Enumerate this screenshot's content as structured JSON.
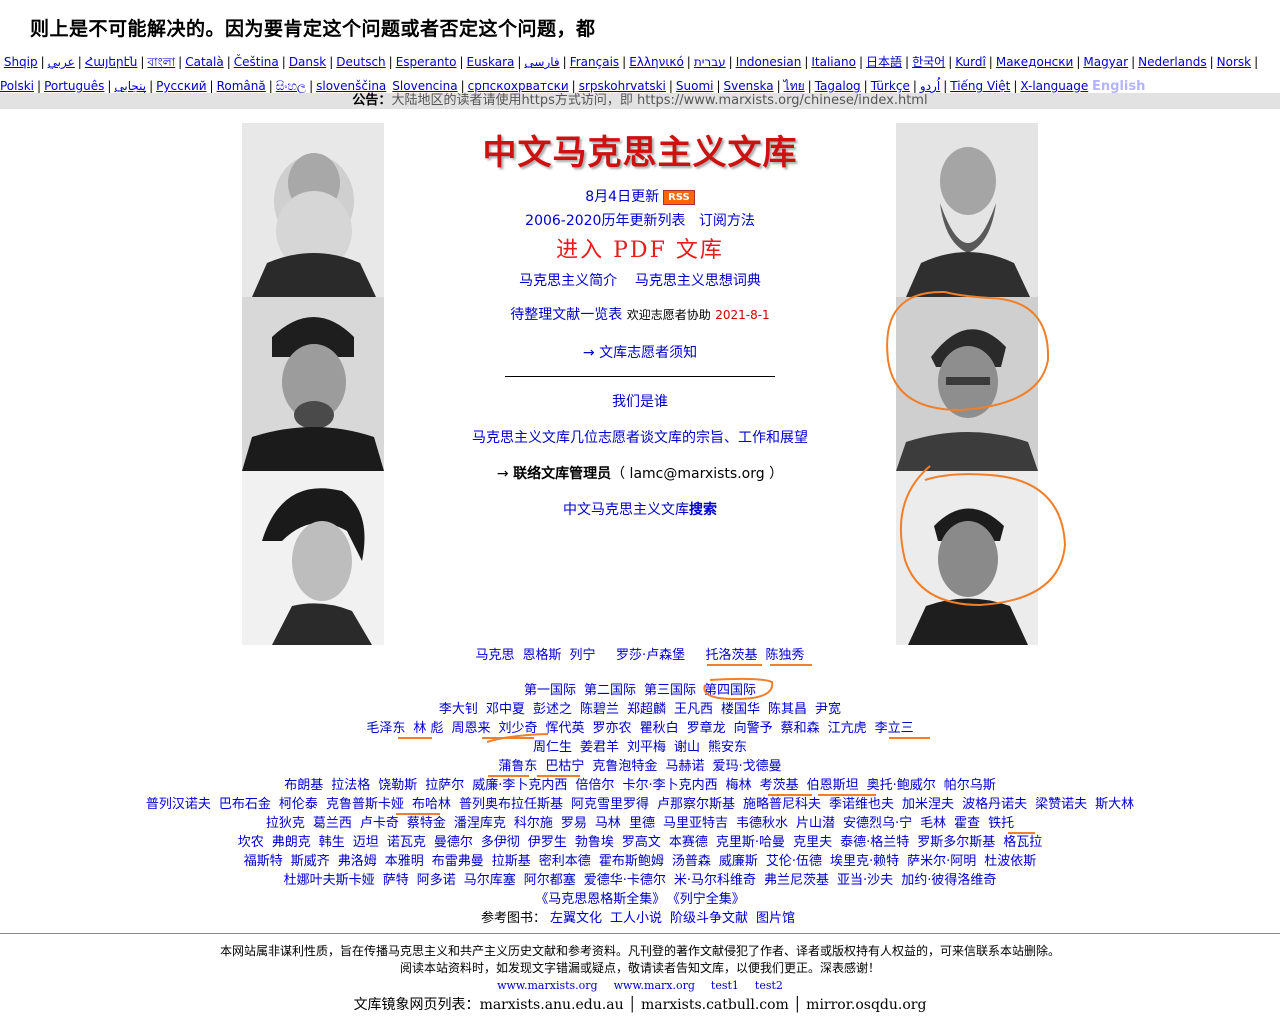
{
  "top_heading": "则上是不可能解决的。因为要肯定这个问题或者否定这个问题，都",
  "languages": {
    "row1": [
      "Shqip",
      "عربي",
      "Հայերէն",
      "বাংলা",
      "Català",
      "Čeština",
      "Dansk",
      "Deutsch",
      "Esperanto",
      "Euskara",
      "فارسی",
      "Français",
      "Ελληνικό",
      "עברית",
      "Indonesian",
      "Italiano",
      "日本語",
      "한국어",
      "Kurdî",
      "Македонски",
      "Magyar",
      "Nederlands",
      "Norsk"
    ],
    "row2": [
      "Polski",
      "Português",
      "پنجابی",
      "Русский",
      "Română",
      "සිංහල",
      "slovenščina",
      "Slovencina",
      "српскохрватски",
      "srpskohrvatski",
      "Suomi",
      "Svenska",
      "ไทย",
      "Tagalog",
      "Türkçe",
      "اُردو",
      "Tiếng Việt",
      "X-language"
    ],
    "english": "English"
  },
  "notice": {
    "label": "公告：",
    "text": "大陆地区的读者请使用https方式访问，即 https://www.marxists.org/chinese/index.html"
  },
  "center": {
    "title": "中文马克思主义文库",
    "update_date": "8月4日更新",
    "rss": "RSS",
    "history": "2006-2020历年更新列表",
    "subscribe": "订阅方法",
    "pdf": "进入 PDF 文库",
    "intro": "马克思主义简介",
    "dictionary": "马克思主义思想词典",
    "pending": "待整理文献一览表",
    "volunteer_help": "欢迎志愿者协助",
    "pending_date": "2021-8-1",
    "volunteer_notice": "→ 文库志愿者须知",
    "who_we_are": "我们是谁",
    "volunteers_talk": "马克思主义文库几位志愿者谈文库的宗旨、工作和展望",
    "contact_arrow": "→",
    "contact_label": "联络文库管理员",
    "contact_email": "（ lamc@marxists.org ）",
    "search_prefix": "中文马克思主义文库",
    "search_label": "搜索"
  },
  "names": {
    "row1": [
      "马克思",
      "恩格斯",
      "列宁",
      "罗莎·卢森堡",
      "托洛茨基",
      "陈独秀"
    ],
    "row2": [
      "第一国际",
      "第二国际",
      "第三国际",
      "第四国际"
    ],
    "row3": [
      "李大钊",
      "邓中夏",
      "彭述之",
      "陈碧兰",
      "郑超麟",
      "王凡西",
      "楼国华",
      "陈其昌",
      "尹宽"
    ],
    "row4": [
      "毛泽东",
      "林 彪",
      "周恩来",
      "刘少奇",
      "恽代英",
      "罗亦农",
      "瞿秋白",
      "罗章龙",
      "向警予",
      "蔡和森",
      "江亢虎",
      "李立三"
    ],
    "row5": [
      "周仁生",
      "姜君羊",
      "刘平梅",
      "谢山",
      "熊安东"
    ],
    "row6": [
      "蒲鲁东",
      "巴枯宁",
      "克鲁泡特金",
      "马赫诺",
      "爱玛·戈德曼"
    ],
    "row7": [
      "布朗基",
      "拉法格",
      "饶勒斯",
      "拉萨尔",
      "威廉·李卜克内西",
      "倍倍尔",
      "卡尔·李卜克内西",
      "梅林",
      "考茨基",
      "伯恩斯坦",
      "奥托·鲍威尔",
      "帕尔乌斯"
    ],
    "row8": [
      "普列汉诺夫",
      "巴布石金",
      "柯伦泰",
      "克鲁普斯卡娅",
      "布哈林",
      "普列奥布拉任斯基",
      "阿克雪里罗得",
      "卢那察尔斯基",
      "施略普尼科夫",
      "季诺维也夫",
      "加米涅夫",
      "波格丹诺夫",
      "梁赞诺夫",
      "斯大林"
    ],
    "row9": [
      "拉狄克",
      "葛兰西",
      "卢卡奇",
      "蔡特金",
      "潘涅库克",
      "科尔施",
      "罗易",
      "马林",
      "里德",
      "马里亚特吉",
      "韦德秋水",
      "片山潜",
      "安德烈乌·宁",
      "毛林",
      "霍查",
      "铁托"
    ],
    "row10": [
      "坎农",
      "弗朗克",
      "韩生",
      "迈坦",
      "诺瓦克",
      "曼德尔",
      "多伊彻",
      "伊罗生",
      "勃鲁埃",
      "罗高文",
      "本赛德",
      "克里斯·哈曼",
      "克里夫",
      "泰德·格兰特",
      "罗斯多尔斯基",
      "格瓦拉"
    ],
    "row11": [
      "福斯特",
      "斯威齐",
      "弗洛姆",
      "本雅明",
      "布雷弗曼",
      "拉斯基",
      "密利本德",
      "霍布斯鲍姆",
      "汤普森",
      "威廉斯",
      "艾伦·伍德",
      "埃里克·赖特",
      "萨米尔·阿明",
      "杜波依斯"
    ],
    "row12": [
      "杜娜叶夫斯卡娅",
      "萨特",
      "阿多诺",
      "马尔库塞",
      "阿尔都塞",
      "爱德华·卡德尔",
      "米·马尔科维奇",
      "弗兰尼茨基",
      "亚当·沙夫",
      "加约·彼得洛维奇"
    ],
    "row13": [
      "《马克思恩格斯全集》",
      "《列宁全集》"
    ],
    "ref_label": "参考图书：",
    "row14": [
      "左翼文化",
      "工人小说",
      "阶级斗争文献",
      "图片馆"
    ]
  },
  "footer": {
    "line1": "本网站属非谋利性质，旨在传播马克思主义和共产主义历史文献和参考资料。凡刊登的著作文献侵犯了作者、译者或版权持有人权益的，可来信联系本站删除。",
    "line2": "阅读本站资料时，如发现文字错漏或疑点，敬请读者告知文库，以便我们更正。深表感谢！",
    "links": [
      "www.marxists.org",
      "www.marx.org",
      "test1",
      "test2"
    ],
    "mirror_label": "文库镜象网页列表：",
    "mirrors": [
      "marxists.anu.edu.au",
      "marxists.catbull.com",
      "mirror.osqdu.org"
    ]
  },
  "colors": {
    "link": "#0000cc",
    "title_red": "#cc1111",
    "annotation_orange": "#f07f2a",
    "notice_bg": "#e2e2e2"
  }
}
